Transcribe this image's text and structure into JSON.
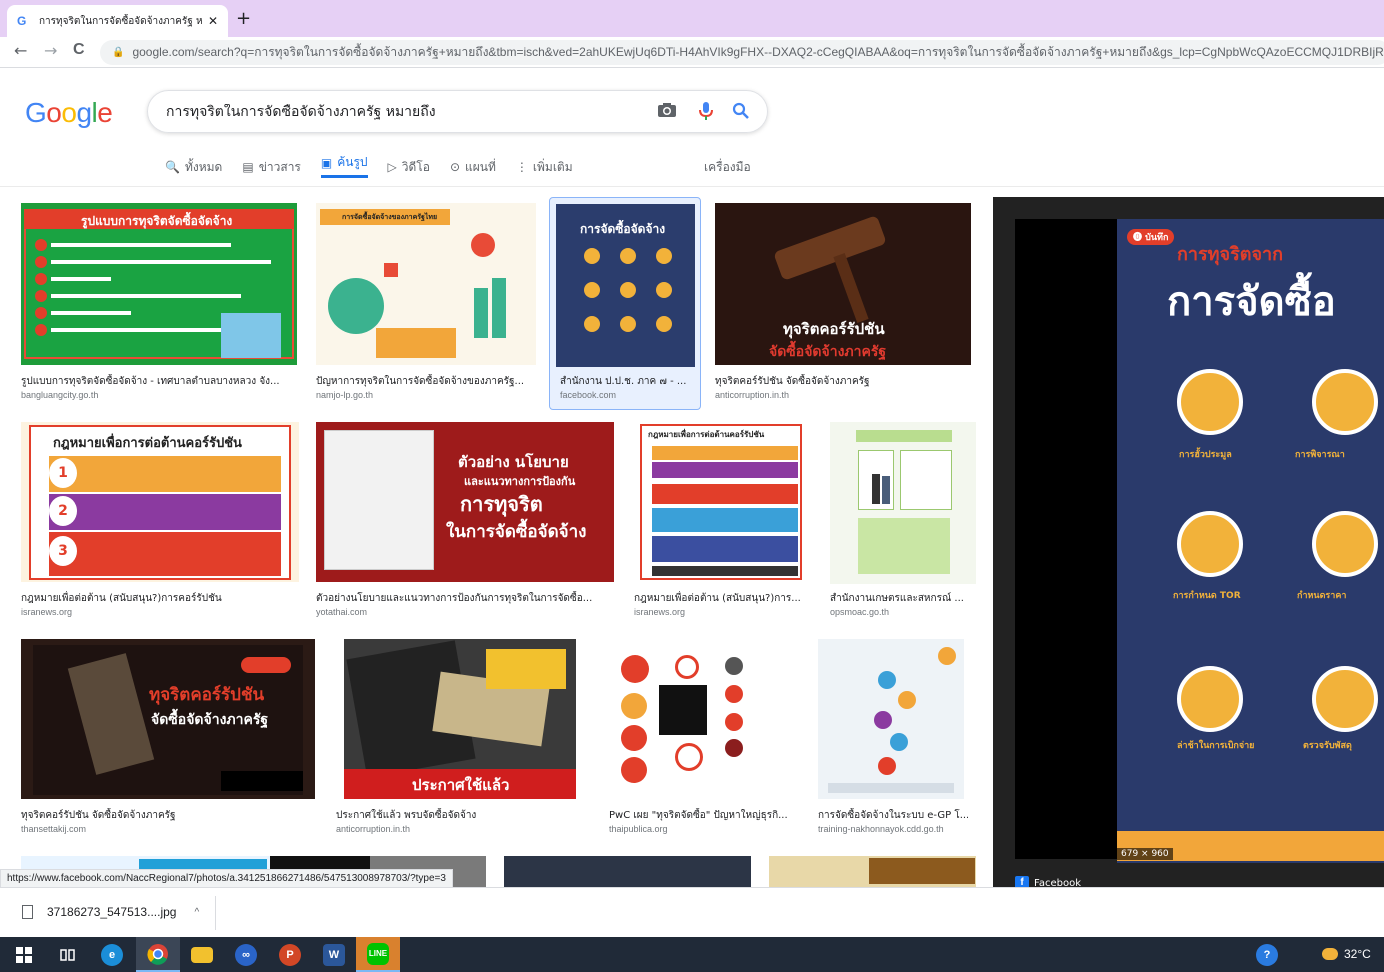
{
  "browser": {
    "tab_title": "การทุจริตในการจัดซื้อจัดจ้างภาครัฐ หม",
    "tab_close": "✕",
    "new_tab": "+",
    "url": "google.com/search?q=การทุจริตในการจัดซื้อจัดจ้างภาครัฐ+หมายถึง&tbm=isch&ved=2ahUKEwjUq6DTi-H4AhVIk9gFHX--DXAQ2-cCegQIABAA&oq=การทุจริตในการจัดซื้อจัดจ้างภาครัฐ+หมายถึง&gs_lcp=CgNpbWcQAzoECCMQJ1DRBIjRBmD",
    "back": "←",
    "forward": "→",
    "reload": "C"
  },
  "google": {
    "logo_letters": [
      "G",
      "o",
      "o",
      "g",
      "l",
      "e"
    ],
    "logo_colors": [
      "#4285f4",
      "#ea4335",
      "#fbbc05",
      "#4285f4",
      "#34a853",
      "#ea4335"
    ],
    "query": "การทุจริตในการจัดซื้อจัดจ้างภาครัฐ หมายถึง",
    "tabs": [
      {
        "label": "ทั้งหมด",
        "icon": "🔍"
      },
      {
        "label": "ข่าวสาร",
        "icon": "▤"
      },
      {
        "label": "ค้นรูป",
        "icon": "▣"
      },
      {
        "label": "วิดีโอ",
        "icon": "▷"
      },
      {
        "label": "แผนที่",
        "icon": "⊙"
      },
      {
        "label": "เพิ่มเติม",
        "icon": "⋮"
      }
    ],
    "tools": "เครื่องมือ"
  },
  "results": [
    {
      "caption": "รูปแบบการทุจริตจัดซื้อจัดจ้าง - เทศบาลตำบลบางหลวง จัง...",
      "source": "bangluangcity.go.th",
      "thumb_title": "รูปแบบการทุจริตจัดซื้อจัดจ้าง"
    },
    {
      "caption": "ปัญหาการทุจริตในการจัดซื้อจัดจ้างของภาครัฐ...",
      "source": "namjo-lp.go.th",
      "thumb_title": "การจัดซื้อจัดจ้างของภาครัฐไทย"
    },
    {
      "caption": "สำนักงาน ป.ป.ช. ภาค ๗ - ...",
      "source": "facebook.com",
      "thumb_title": "การจัดซื้อจัดจ้าง"
    },
    {
      "caption": "ทุจริตคอร์รัปชัน จัดซื้อจัดจ้างภาครัฐ",
      "source": "anticorruption.in.th",
      "thumb_title": "ทุจริตคอร์รัปชัน",
      "thumb_sub": "จัดซื้อจัดจ้างภาครัฐ"
    },
    {
      "caption": "กฎหมายเพื่อต่อต้าน (สนับสนุน?)การคอร์รัปชัน",
      "source": "isranews.org",
      "thumb_title": "กฎหมายเพื่อการต่อต้านคอร์รัปชัน"
    },
    {
      "caption": "ตัวอย่างนโยบายและแนวทางการป้องกันการทุจริตในการจัดซื้อ...",
      "source": "yotathai.com",
      "thumb_title": "ตัวอย่าง นโยบาย",
      "thumb_sub": "และแนวทางการป้องกัน"
    },
    {
      "caption": "กฎหมายเพื่อต่อต้าน (สนับสนุน?)การ...",
      "source": "isranews.org",
      "thumb_title": "กฎหมายเพื่อการต่อต้านคอร์รัปชัน"
    },
    {
      "caption": "สำนักงานเกษตรและสหกรณ์ ...",
      "source": "opsmoac.go.th",
      "thumb_title": ""
    },
    {
      "caption": "ทุจริตคอร์รัปชัน จัดซื้อจัดจ้างภาครัฐ",
      "source": "thansettakij.com",
      "thumb_title": "ทุจริตคอร์รัปชัน",
      "thumb_sub": "จัดซื้อจัดจ้างภาครัฐ"
    },
    {
      "caption": "ประกาศใช้แล้ว พรบจัดซื้อจัดจ้าง",
      "source": "anticorruption.in.th",
      "thumb_title": "ประกาศใช้แล้ว"
    },
    {
      "caption": "PwC เผย \"ทุจริตจัดซื้อ\" ปัญหาใหญ่ธุรกิ...",
      "source": "thaipublica.org",
      "thumb_title": ""
    },
    {
      "caption": "การจัดซื้อจัดจ้างในระบบ e-GP โ...",
      "source": "training-nakhonnayok.cdd.go.th",
      "thumb_title": ""
    }
  ],
  "preview": {
    "close": "✕",
    "save_badge": "บันทึก",
    "title_top": "การทุจริตจาก",
    "title_main": "การจัดซื้อ",
    "labels": [
      "การฮั้วประมูล",
      "การพิจารณา",
      "การกำหนด TOR",
      "กำหนดราคา",
      "ล่าช้าในการเบิกจ่าย",
      "ตรวจรับพัสดุ"
    ],
    "size": "679 × 960",
    "source": "Facebook"
  },
  "status_url": "https://www.facebook.com/NaccRegional7/photos/a.341251866271486/547513008978703/?type=3",
  "download": {
    "filename": "37186273_547513....jpg",
    "chevron": "^"
  },
  "taskbar": {
    "temp": "32°C"
  }
}
